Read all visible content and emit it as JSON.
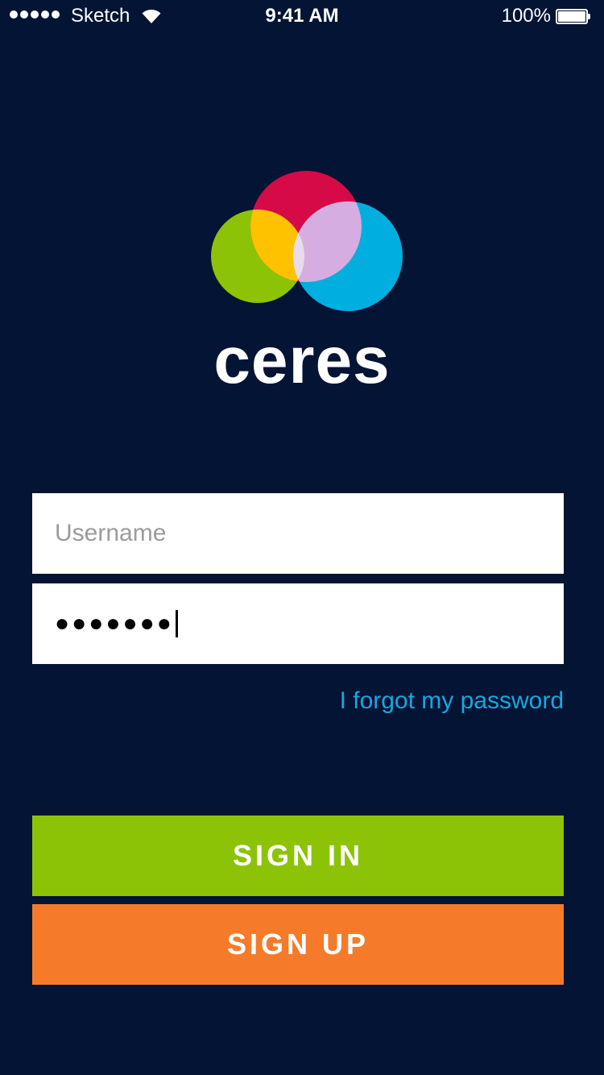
{
  "status_bar": {
    "carrier": "Sketch",
    "time": "9:41 AM",
    "battery": "100%",
    "signal_bars": 5
  },
  "logo": {
    "wordmark": "ceres",
    "colors": {
      "green": "#8dc306",
      "red": "#d50a46",
      "blue": "#00aee0",
      "yellow": "#ffc200",
      "lilac": "#d6ade0",
      "center": "#e8dcea"
    }
  },
  "form": {
    "username": {
      "placeholder": "Username",
      "value": ""
    },
    "password": {
      "masked_value": "●●●●●●●"
    },
    "forgot_label": "I forgot my password"
  },
  "buttons": {
    "signin_label": "SIGN IN",
    "signup_label": "SIGN UP"
  },
  "colors": {
    "background": "#041434",
    "link": "#17a7e0",
    "signin": "#8dc306",
    "signup": "#f57b2a"
  }
}
